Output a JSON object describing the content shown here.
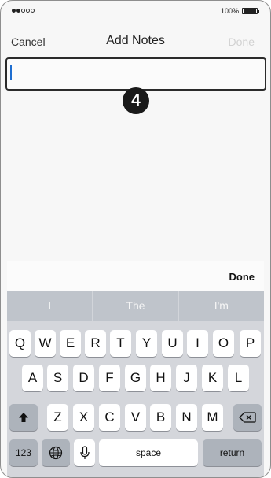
{
  "status_bar": {
    "signal_dots": [
      true,
      true,
      false,
      false,
      false
    ],
    "battery_text": "100%",
    "battery_level": 1.0
  },
  "nav_bar": {
    "cancel_label": "Cancel",
    "title": "Add Notes",
    "done_label": "Done"
  },
  "notes_field": {
    "value": "",
    "has_focus": true
  },
  "step_badge": "4",
  "toolbar": {
    "done_label": "Done"
  },
  "keyboard": {
    "predictions": [
      "I",
      "The",
      "I'm"
    ],
    "row1": [
      "Q",
      "W",
      "E",
      "R",
      "T",
      "Y",
      "U",
      "I",
      "O",
      "P"
    ],
    "row2": [
      "A",
      "S",
      "D",
      "F",
      "G",
      "H",
      "J",
      "K",
      "L"
    ],
    "row3": [
      "Z",
      "X",
      "C",
      "V",
      "B",
      "N",
      "M"
    ],
    "numbers_label": "123",
    "space_label": "space",
    "return_label": "return",
    "icons": {
      "shift": "shift-icon",
      "delete": "backspace-icon",
      "globe": "globe-icon",
      "mic": "microphone-icon"
    }
  },
  "colors": {
    "caret": "#1e6ed0",
    "keyboard_bg": "#d4d6db",
    "done_disabled": "#d2d2d2"
  }
}
